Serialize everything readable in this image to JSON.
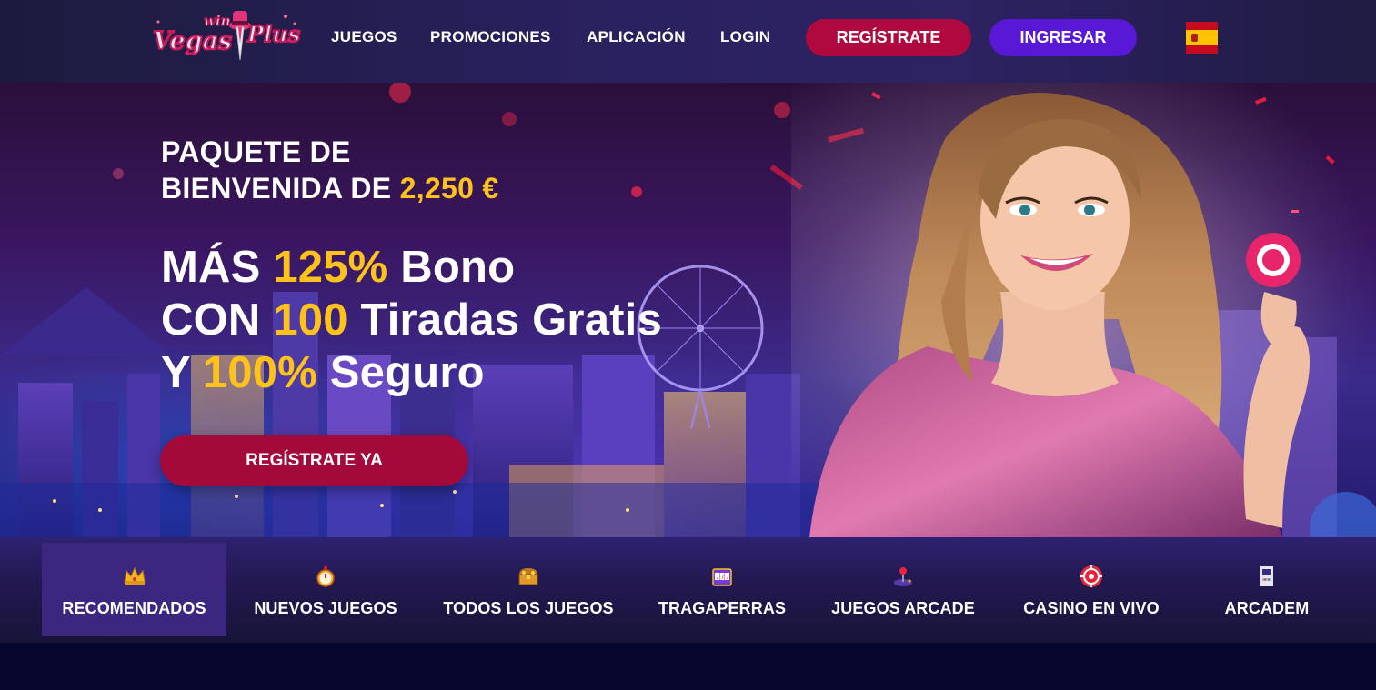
{
  "brand": {
    "logo_word_small": "win",
    "logo_word_1": "Vegas",
    "logo_word_2": "Plus"
  },
  "nav": {
    "games": "JUEGOS",
    "promotions": "PROMOCIONES",
    "app": "APLICACIÓN",
    "login": "LOGIN",
    "register": "REGÍSTRATE",
    "signin": "INGRESAR"
  },
  "language_flag": "es",
  "hero": {
    "line1": "PAQUETE DE",
    "line2_prefix": "BIENVENIDA DE ",
    "line2_amount": "2,250 €",
    "b1_pre": "MÁS ",
    "b1_hi": "125%",
    "b1_post": " Bono",
    "b2_pre": "CON ",
    "b2_hi": "100",
    "b2_post": " Tiradas Gratis",
    "b3_pre": "Y ",
    "b3_hi": "100%",
    "b3_post": " Seguro",
    "cta": "REGÍSTRATE YA"
  },
  "categories": [
    {
      "label": "RECOMENDADOS",
      "icon": "crown-icon",
      "active": true
    },
    {
      "label": "NUEVOS JUEGOS",
      "icon": "stopwatch-icon",
      "active": false
    },
    {
      "label": "TODOS LOS JUEGOS",
      "icon": "treasure-chest-icon",
      "active": false
    },
    {
      "label": "TRAGAPERRAS",
      "icon": "slot-machine-icon",
      "active": false
    },
    {
      "label": "JUEGOS ARCADE",
      "icon": "joystick-icon",
      "active": false
    },
    {
      "label": "CASINO EN VIVO",
      "icon": "roulette-icon",
      "active": false
    },
    {
      "label": "ARCADEM",
      "icon": "arcade-cabinet-icon",
      "active": false
    }
  ],
  "colors": {
    "accent_gold": "#ffc21a",
    "register_red": "#b0093f",
    "signin_purple": "#5818d6"
  }
}
